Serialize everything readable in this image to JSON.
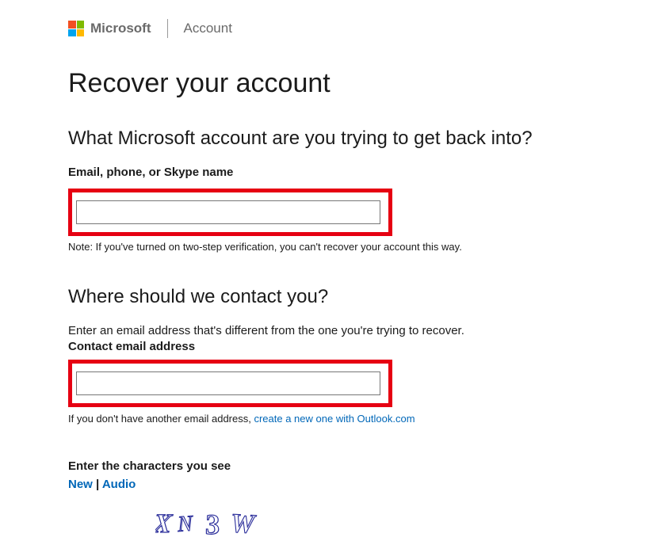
{
  "header": {
    "brand": "Microsoft",
    "section": "Account"
  },
  "page": {
    "title": "Recover your account"
  },
  "section1": {
    "heading": "What Microsoft account are you trying to get back into?",
    "label": "Email, phone, or Skype name",
    "input_value": "",
    "note": "Note: If you've turned on two-step verification, you can't recover your account this way."
  },
  "section2": {
    "heading": "Where should we contact you?",
    "instruction": "Enter an email address that's different from the one you're trying to recover.",
    "label": "Contact email address",
    "input_value": "",
    "help_prefix": "If you don't have another email address, ",
    "help_link": "create a new one with Outlook.com"
  },
  "section3": {
    "label": "Enter the characters you see",
    "new_link": "New",
    "separator": " | ",
    "audio_link": "Audio",
    "captcha_text": "XN3W"
  },
  "colors": {
    "link": "#0067b8",
    "highlight": "#e60012"
  }
}
